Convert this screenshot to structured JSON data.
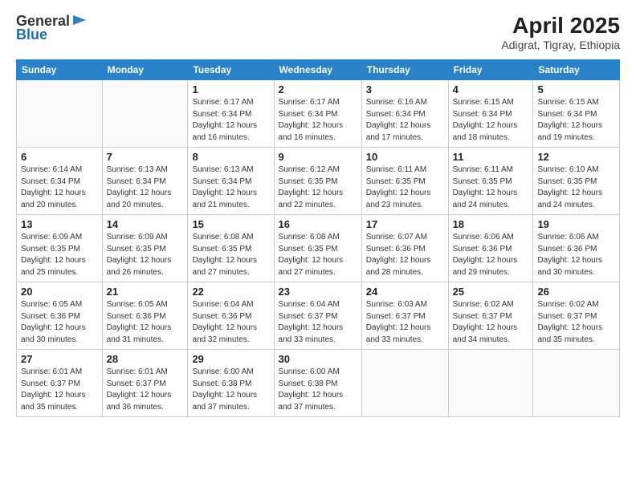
{
  "header": {
    "logo_general": "General",
    "logo_blue": "Blue",
    "month_year": "April 2025",
    "location": "Adigrat, Tigray, Ethiopia"
  },
  "weekdays": [
    "Sunday",
    "Monday",
    "Tuesday",
    "Wednesday",
    "Thursday",
    "Friday",
    "Saturday"
  ],
  "weeks": [
    [
      {
        "day": "",
        "sunrise": "",
        "sunset": "",
        "daylight": ""
      },
      {
        "day": "",
        "sunrise": "",
        "sunset": "",
        "daylight": ""
      },
      {
        "day": "1",
        "sunrise": "Sunrise: 6:17 AM",
        "sunset": "Sunset: 6:34 PM",
        "daylight": "Daylight: 12 hours and 16 minutes."
      },
      {
        "day": "2",
        "sunrise": "Sunrise: 6:17 AM",
        "sunset": "Sunset: 6:34 PM",
        "daylight": "Daylight: 12 hours and 16 minutes."
      },
      {
        "day": "3",
        "sunrise": "Sunrise: 6:16 AM",
        "sunset": "Sunset: 6:34 PM",
        "daylight": "Daylight: 12 hours and 17 minutes."
      },
      {
        "day": "4",
        "sunrise": "Sunrise: 6:15 AM",
        "sunset": "Sunset: 6:34 PM",
        "daylight": "Daylight: 12 hours and 18 minutes."
      },
      {
        "day": "5",
        "sunrise": "Sunrise: 6:15 AM",
        "sunset": "Sunset: 6:34 PM",
        "daylight": "Daylight: 12 hours and 19 minutes."
      }
    ],
    [
      {
        "day": "6",
        "sunrise": "Sunrise: 6:14 AM",
        "sunset": "Sunset: 6:34 PM",
        "daylight": "Daylight: 12 hours and 20 minutes."
      },
      {
        "day": "7",
        "sunrise": "Sunrise: 6:13 AM",
        "sunset": "Sunset: 6:34 PM",
        "daylight": "Daylight: 12 hours and 20 minutes."
      },
      {
        "day": "8",
        "sunrise": "Sunrise: 6:13 AM",
        "sunset": "Sunset: 6:34 PM",
        "daylight": "Daylight: 12 hours and 21 minutes."
      },
      {
        "day": "9",
        "sunrise": "Sunrise: 6:12 AM",
        "sunset": "Sunset: 6:35 PM",
        "daylight": "Daylight: 12 hours and 22 minutes."
      },
      {
        "day": "10",
        "sunrise": "Sunrise: 6:11 AM",
        "sunset": "Sunset: 6:35 PM",
        "daylight": "Daylight: 12 hours and 23 minutes."
      },
      {
        "day": "11",
        "sunrise": "Sunrise: 6:11 AM",
        "sunset": "Sunset: 6:35 PM",
        "daylight": "Daylight: 12 hours and 24 minutes."
      },
      {
        "day": "12",
        "sunrise": "Sunrise: 6:10 AM",
        "sunset": "Sunset: 6:35 PM",
        "daylight": "Daylight: 12 hours and 24 minutes."
      }
    ],
    [
      {
        "day": "13",
        "sunrise": "Sunrise: 6:09 AM",
        "sunset": "Sunset: 6:35 PM",
        "daylight": "Daylight: 12 hours and 25 minutes."
      },
      {
        "day": "14",
        "sunrise": "Sunrise: 6:09 AM",
        "sunset": "Sunset: 6:35 PM",
        "daylight": "Daylight: 12 hours and 26 minutes."
      },
      {
        "day": "15",
        "sunrise": "Sunrise: 6:08 AM",
        "sunset": "Sunset: 6:35 PM",
        "daylight": "Daylight: 12 hours and 27 minutes."
      },
      {
        "day": "16",
        "sunrise": "Sunrise: 6:08 AM",
        "sunset": "Sunset: 6:35 PM",
        "daylight": "Daylight: 12 hours and 27 minutes."
      },
      {
        "day": "17",
        "sunrise": "Sunrise: 6:07 AM",
        "sunset": "Sunset: 6:36 PM",
        "daylight": "Daylight: 12 hours and 28 minutes."
      },
      {
        "day": "18",
        "sunrise": "Sunrise: 6:06 AM",
        "sunset": "Sunset: 6:36 PM",
        "daylight": "Daylight: 12 hours and 29 minutes."
      },
      {
        "day": "19",
        "sunrise": "Sunrise: 6:06 AM",
        "sunset": "Sunset: 6:36 PM",
        "daylight": "Daylight: 12 hours and 30 minutes."
      }
    ],
    [
      {
        "day": "20",
        "sunrise": "Sunrise: 6:05 AM",
        "sunset": "Sunset: 6:36 PM",
        "daylight": "Daylight: 12 hours and 30 minutes."
      },
      {
        "day": "21",
        "sunrise": "Sunrise: 6:05 AM",
        "sunset": "Sunset: 6:36 PM",
        "daylight": "Daylight: 12 hours and 31 minutes."
      },
      {
        "day": "22",
        "sunrise": "Sunrise: 6:04 AM",
        "sunset": "Sunset: 6:36 PM",
        "daylight": "Daylight: 12 hours and 32 minutes."
      },
      {
        "day": "23",
        "sunrise": "Sunrise: 6:04 AM",
        "sunset": "Sunset: 6:37 PM",
        "daylight": "Daylight: 12 hours and 33 minutes."
      },
      {
        "day": "24",
        "sunrise": "Sunrise: 6:03 AM",
        "sunset": "Sunset: 6:37 PM",
        "daylight": "Daylight: 12 hours and 33 minutes."
      },
      {
        "day": "25",
        "sunrise": "Sunrise: 6:02 AM",
        "sunset": "Sunset: 6:37 PM",
        "daylight": "Daylight: 12 hours and 34 minutes."
      },
      {
        "day": "26",
        "sunrise": "Sunrise: 6:02 AM",
        "sunset": "Sunset: 6:37 PM",
        "daylight": "Daylight: 12 hours and 35 minutes."
      }
    ],
    [
      {
        "day": "27",
        "sunrise": "Sunrise: 6:01 AM",
        "sunset": "Sunset: 6:37 PM",
        "daylight": "Daylight: 12 hours and 35 minutes."
      },
      {
        "day": "28",
        "sunrise": "Sunrise: 6:01 AM",
        "sunset": "Sunset: 6:37 PM",
        "daylight": "Daylight: 12 hours and 36 minutes."
      },
      {
        "day": "29",
        "sunrise": "Sunrise: 6:00 AM",
        "sunset": "Sunset: 6:38 PM",
        "daylight": "Daylight: 12 hours and 37 minutes."
      },
      {
        "day": "30",
        "sunrise": "Sunrise: 6:00 AM",
        "sunset": "Sunset: 6:38 PM",
        "daylight": "Daylight: 12 hours and 37 minutes."
      },
      {
        "day": "",
        "sunrise": "",
        "sunset": "",
        "daylight": ""
      },
      {
        "day": "",
        "sunrise": "",
        "sunset": "",
        "daylight": ""
      },
      {
        "day": "",
        "sunrise": "",
        "sunset": "",
        "daylight": ""
      }
    ]
  ]
}
